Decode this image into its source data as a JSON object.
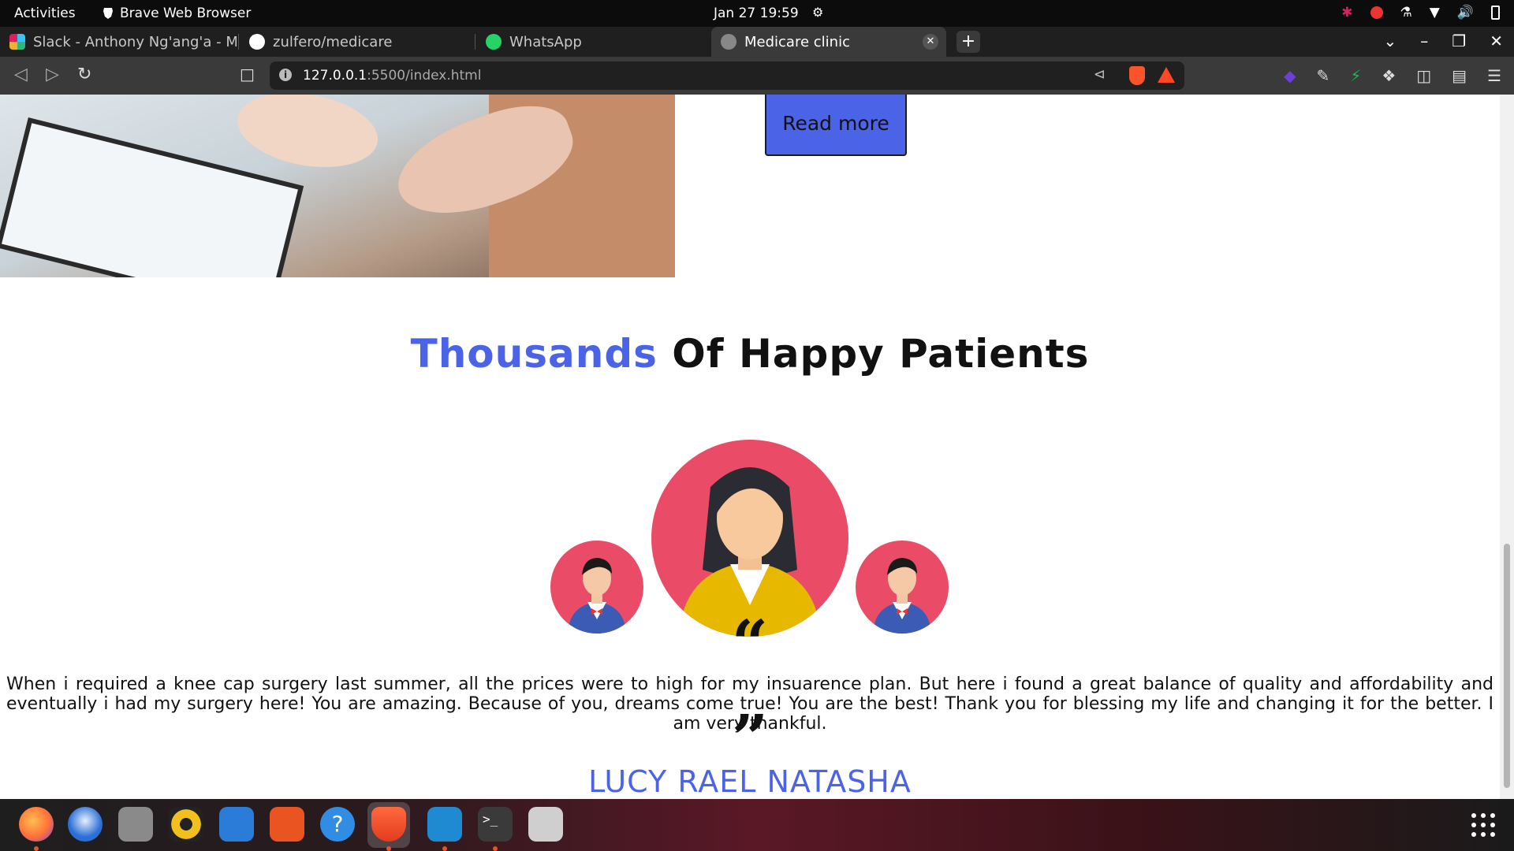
{
  "system_bar": {
    "activities": "Activities",
    "app_name": "Brave Web Browser",
    "clock": "Jan 27  19:59"
  },
  "tabs": [
    {
      "label": "Slack - Anthony Ng'ang'a - MY",
      "icon": "slack-icon"
    },
    {
      "label": "zulfero/medicare",
      "icon": "github-icon"
    },
    {
      "label": "WhatsApp",
      "icon": "whatsapp-icon"
    },
    {
      "label": "Medicare clinic",
      "icon": "globe-icon",
      "active": true
    }
  ],
  "address_bar": {
    "host": "127.0.0.1",
    "path": ":5500/index.html"
  },
  "page": {
    "read_more": "Read more",
    "section_title_accent": "Thousands",
    "section_title_rest": " Of Happy Patients",
    "testimonial": "When i required a knee cap surgery last summer, all the prices were to high for my insuarence plan. But here i found a great balance of quality and affordability and eventually i had my surgery here! You are amazing. Because of you, dreams come true! You are the best! Thank you for blessing my life and changing it for the better. I am very thankful.",
    "patient_name": "LUCY RAEL NATASHA",
    "quote_open": "“",
    "quote_close": "”"
  },
  "colors": {
    "accent": "#4a63e7",
    "avatar_bg": "#ea4c68"
  },
  "dock": [
    {
      "name": "firefox-icon"
    },
    {
      "name": "thunderbird-icon"
    },
    {
      "name": "files-icon"
    },
    {
      "name": "rhythmbox-icon"
    },
    {
      "name": "libreoffice-writer-icon"
    },
    {
      "name": "software-center-icon"
    },
    {
      "name": "help-icon"
    },
    {
      "name": "brave-icon"
    },
    {
      "name": "vscode-icon"
    },
    {
      "name": "terminal-icon"
    },
    {
      "name": "trash-icon"
    }
  ]
}
